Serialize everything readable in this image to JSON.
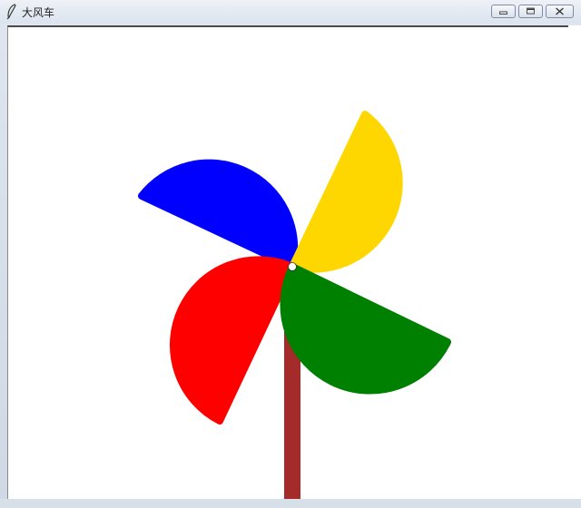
{
  "window": {
    "title": "大风车",
    "app_icon": "feather-icon",
    "controls": {
      "minimize_icon": "minimize-icon",
      "maximize_icon": "maximize-icon",
      "close_icon": "close-icon"
    }
  },
  "pinwheel": {
    "colors": {
      "blade_top_left": "#0000ff",
      "blade_top_right": "#ffd700",
      "blade_bottom_left": "#ff0000",
      "blade_bottom_right": "#008000",
      "stick": "#a52a2a",
      "hub_pin": "#ffffff"
    }
  }
}
